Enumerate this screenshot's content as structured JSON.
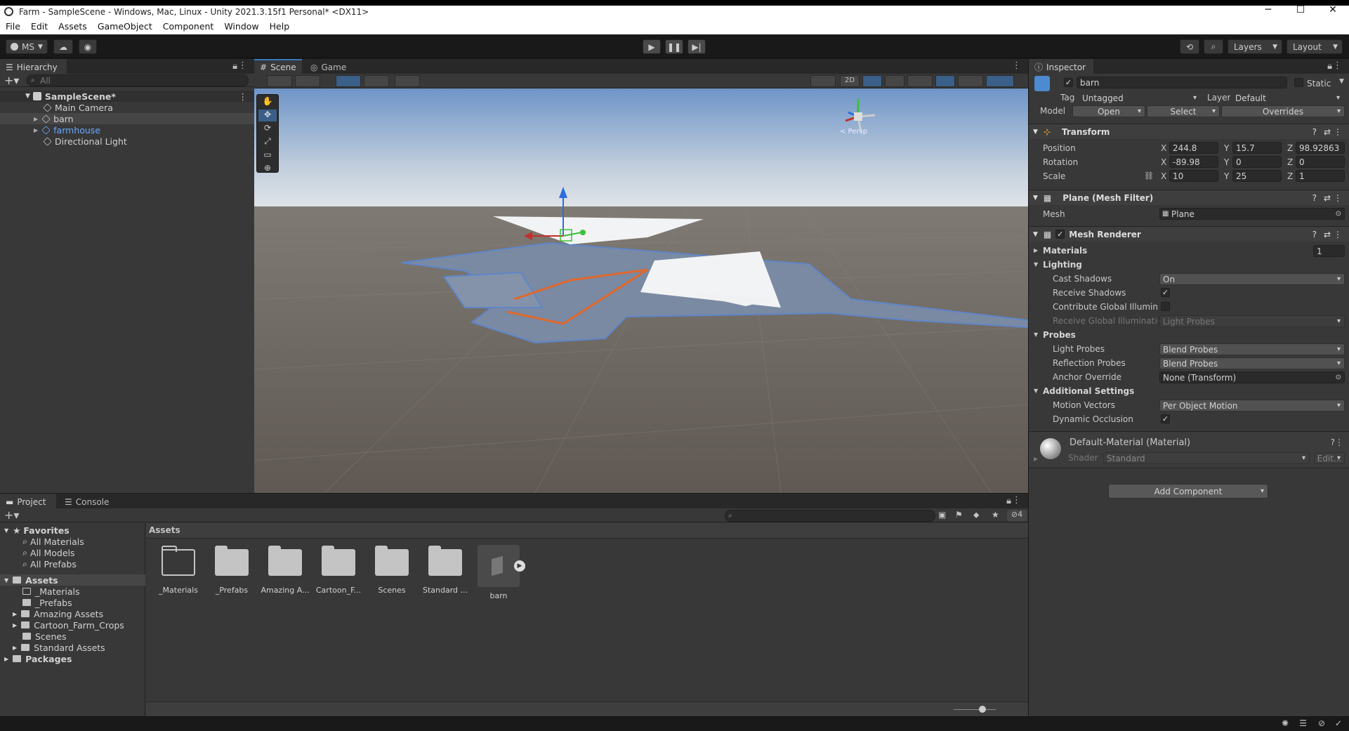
{
  "window": {
    "title": "Farm - SampleScene - Windows, Mac, Linux - Unity 2021.3.15f1 Personal* <DX11>",
    "minimize": "─",
    "maximize": "☐",
    "close": "✕"
  },
  "menu": [
    "File",
    "Edit",
    "Assets",
    "GameObject",
    "Component",
    "Window",
    "Help"
  ],
  "toolbar": {
    "account": "MS",
    "layers": "Layers",
    "layout": "Layout"
  },
  "hierarchy": {
    "tab": "Hierarchy",
    "search_placeholder": "All",
    "scene": "SampleScene*",
    "items": [
      "Main Camera",
      "barn",
      "farmhouse",
      "Directional Light"
    ]
  },
  "scene": {
    "tabs": [
      "Scene",
      "Game"
    ],
    "mode_2d": "2D",
    "persp_label": "< Persp"
  },
  "inspector": {
    "tab": "Inspector",
    "object_name": "barn",
    "static_label": "Static",
    "tag_label": "Tag",
    "tag_value": "Untagged",
    "layer_label": "Layer",
    "layer_value": "Default",
    "model_label": "Model",
    "open": "Open",
    "select": "Select",
    "overrides": "Overrides",
    "transform": {
      "title": "Transform",
      "position_label": "Position",
      "rotation_label": "Rotation",
      "scale_label": "Scale",
      "position": {
        "x": "244.8",
        "y": "15.7",
        "z": "98.92863"
      },
      "rotation": {
        "x": "-89.98",
        "y": "0",
        "z": "0"
      },
      "scale": {
        "x": "10",
        "y": "25",
        "z": "1"
      }
    },
    "mesh_filter": {
      "title": "Plane (Mesh Filter)",
      "mesh_label": "Mesh",
      "mesh_value": "Plane"
    },
    "mesh_renderer": {
      "title": "Mesh Renderer",
      "materials_label": "Materials",
      "materials_count": "1",
      "lighting_label": "Lighting",
      "cast_shadows_label": "Cast Shadows",
      "cast_shadows_value": "On",
      "receive_shadows_label": "Receive Shadows",
      "contribute_gi_label": "Contribute Global Illuminat",
      "receive_gi_label": "Receive Global Illuminatio",
      "receive_gi_value": "Light Probes",
      "probes_label": "Probes",
      "light_probes_label": "Light Probes",
      "light_probes_value": "Blend Probes",
      "reflection_probes_label": "Reflection Probes",
      "reflection_probes_value": "Blend Probes",
      "anchor_override_label": "Anchor Override",
      "anchor_override_value": "None (Transform)",
      "additional_label": "Additional Settings",
      "motion_vectors_label": "Motion Vectors",
      "motion_vectors_value": "Per Object Motion",
      "dynamic_occlusion_label": "Dynamic Occlusion"
    },
    "material": {
      "title": "Default-Material (Material)",
      "shader_label": "Shader",
      "shader_value": "Standard",
      "edit": "Edit..."
    },
    "add_component": "Add Component"
  },
  "project": {
    "tabs": [
      "Project",
      "Console"
    ],
    "hidden_count": "4",
    "favorites_label": "Favorites",
    "favorites": [
      "All Materials",
      "All Models",
      "All Prefabs"
    ],
    "assets_label": "Assets",
    "asset_folders": [
      "_Materials",
      "_Prefabs",
      "Amazing Assets",
      "Cartoon_Farm_Crops",
      "Scenes",
      "Standard Assets"
    ],
    "packages_label": "Packages",
    "breadcrumb": "Assets",
    "grid": [
      "_Materials",
      "_Prefabs",
      "Amazing A...",
      "Cartoon_F...",
      "Scenes",
      "Standard ...",
      "barn"
    ]
  }
}
